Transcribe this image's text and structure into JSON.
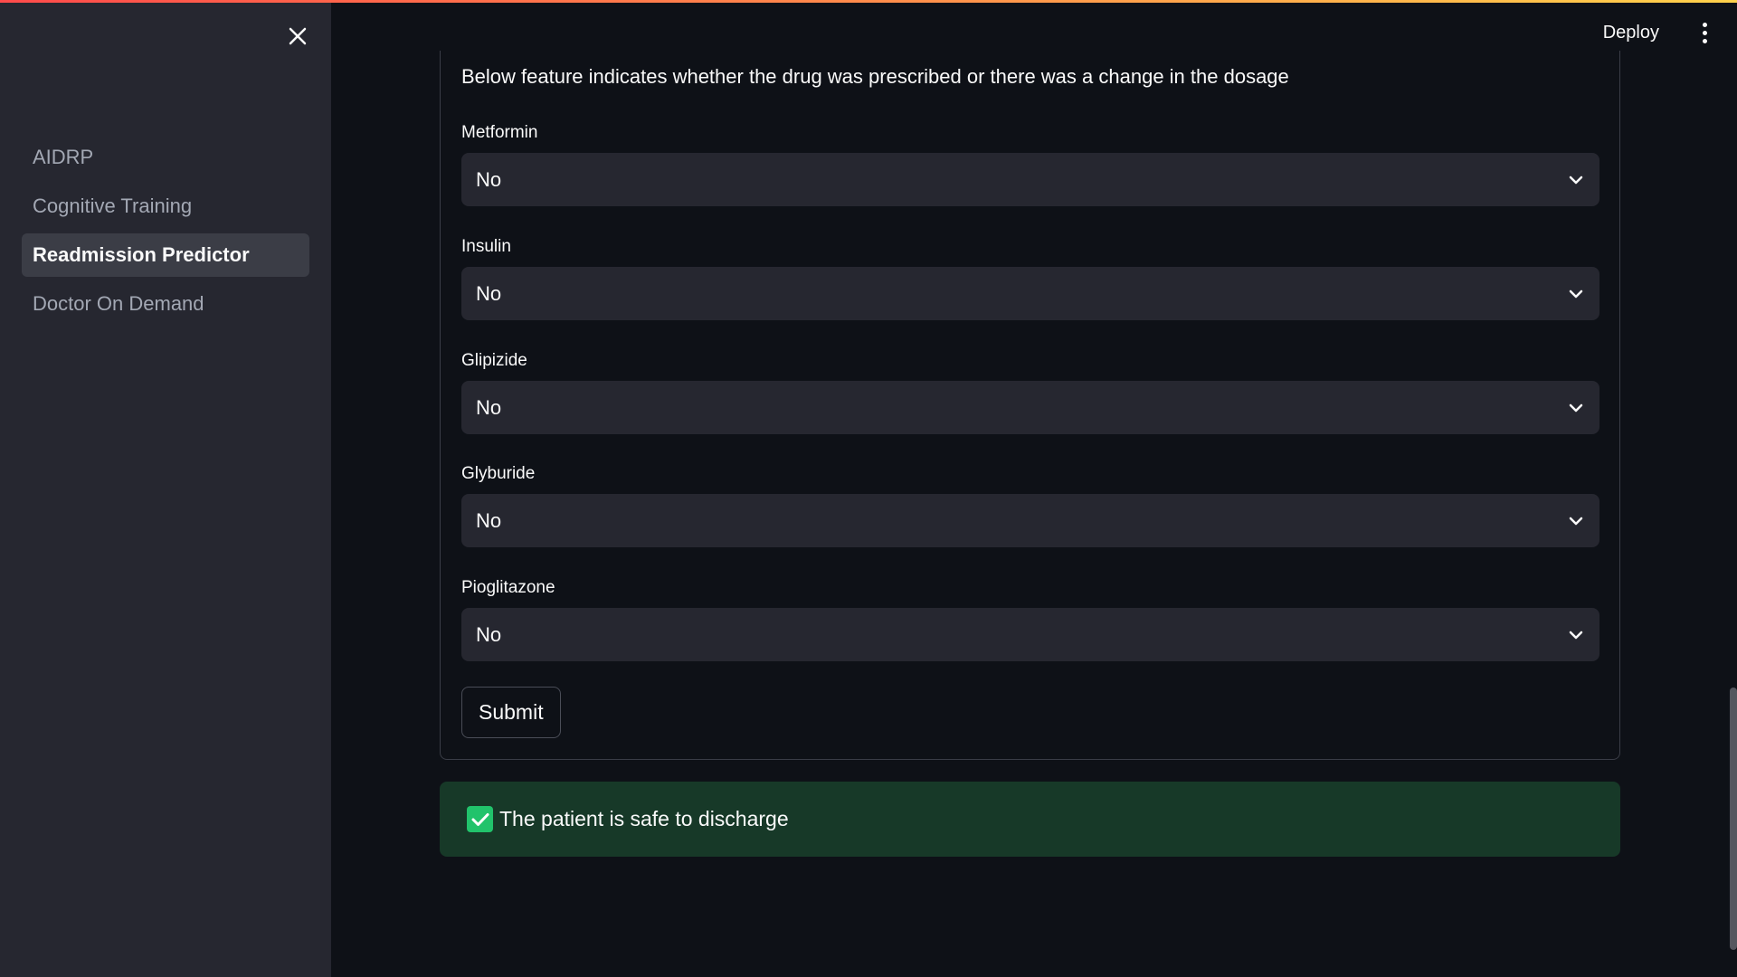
{
  "sidebar": {
    "items": [
      {
        "label": "AIDRP"
      },
      {
        "label": "Cognitive Training"
      },
      {
        "label": "Readmission Predictor"
      },
      {
        "label": "Doctor On Demand"
      }
    ],
    "active_index": 2
  },
  "header": {
    "deploy_label": "Deploy"
  },
  "form": {
    "intro": "Below feature indicates whether the drug was prescribed or there was a change in the dosage",
    "fields": [
      {
        "label": "Metformin",
        "value": "No"
      },
      {
        "label": "Insulin",
        "value": "No"
      },
      {
        "label": "Glipizide",
        "value": "No"
      },
      {
        "label": "Glyburide",
        "value": "No"
      },
      {
        "label": "Pioglitazone",
        "value": "No"
      }
    ],
    "submit_label": "Submit"
  },
  "alert": {
    "text": "The patient is safe to discharge",
    "color": "#173928",
    "icon": "check-icon"
  },
  "colors": {
    "background": "#0e1117",
    "sidebar": "#262730",
    "input": "#262730",
    "success": "#21c36b"
  }
}
